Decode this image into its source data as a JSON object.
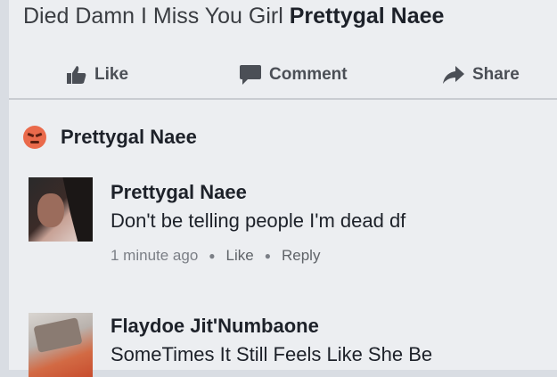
{
  "post": {
    "text": "Died Damn I Miss You Girl",
    "tagged_name": "Prettygal Naee"
  },
  "actions": {
    "like": "Like",
    "comment": "Comment",
    "share": "Share"
  },
  "reaction": {
    "name": "Prettygal Naee",
    "emoji": "angry-reaction-icon"
  },
  "comments": [
    {
      "name": "Prettygal Naee",
      "text": "Don't be telling people I'm dead df",
      "time": "1 minute ago",
      "like": "Like",
      "reply": "Reply"
    },
    {
      "name": "Flaydoe Jit'Numbaone",
      "text": "SomeTimes It Still Feels Like She Be"
    }
  ],
  "colors": {
    "background": "#eceef1",
    "text": "#1d2129",
    "muted": "#7b7f86",
    "reaction": "#ea6a4b"
  }
}
